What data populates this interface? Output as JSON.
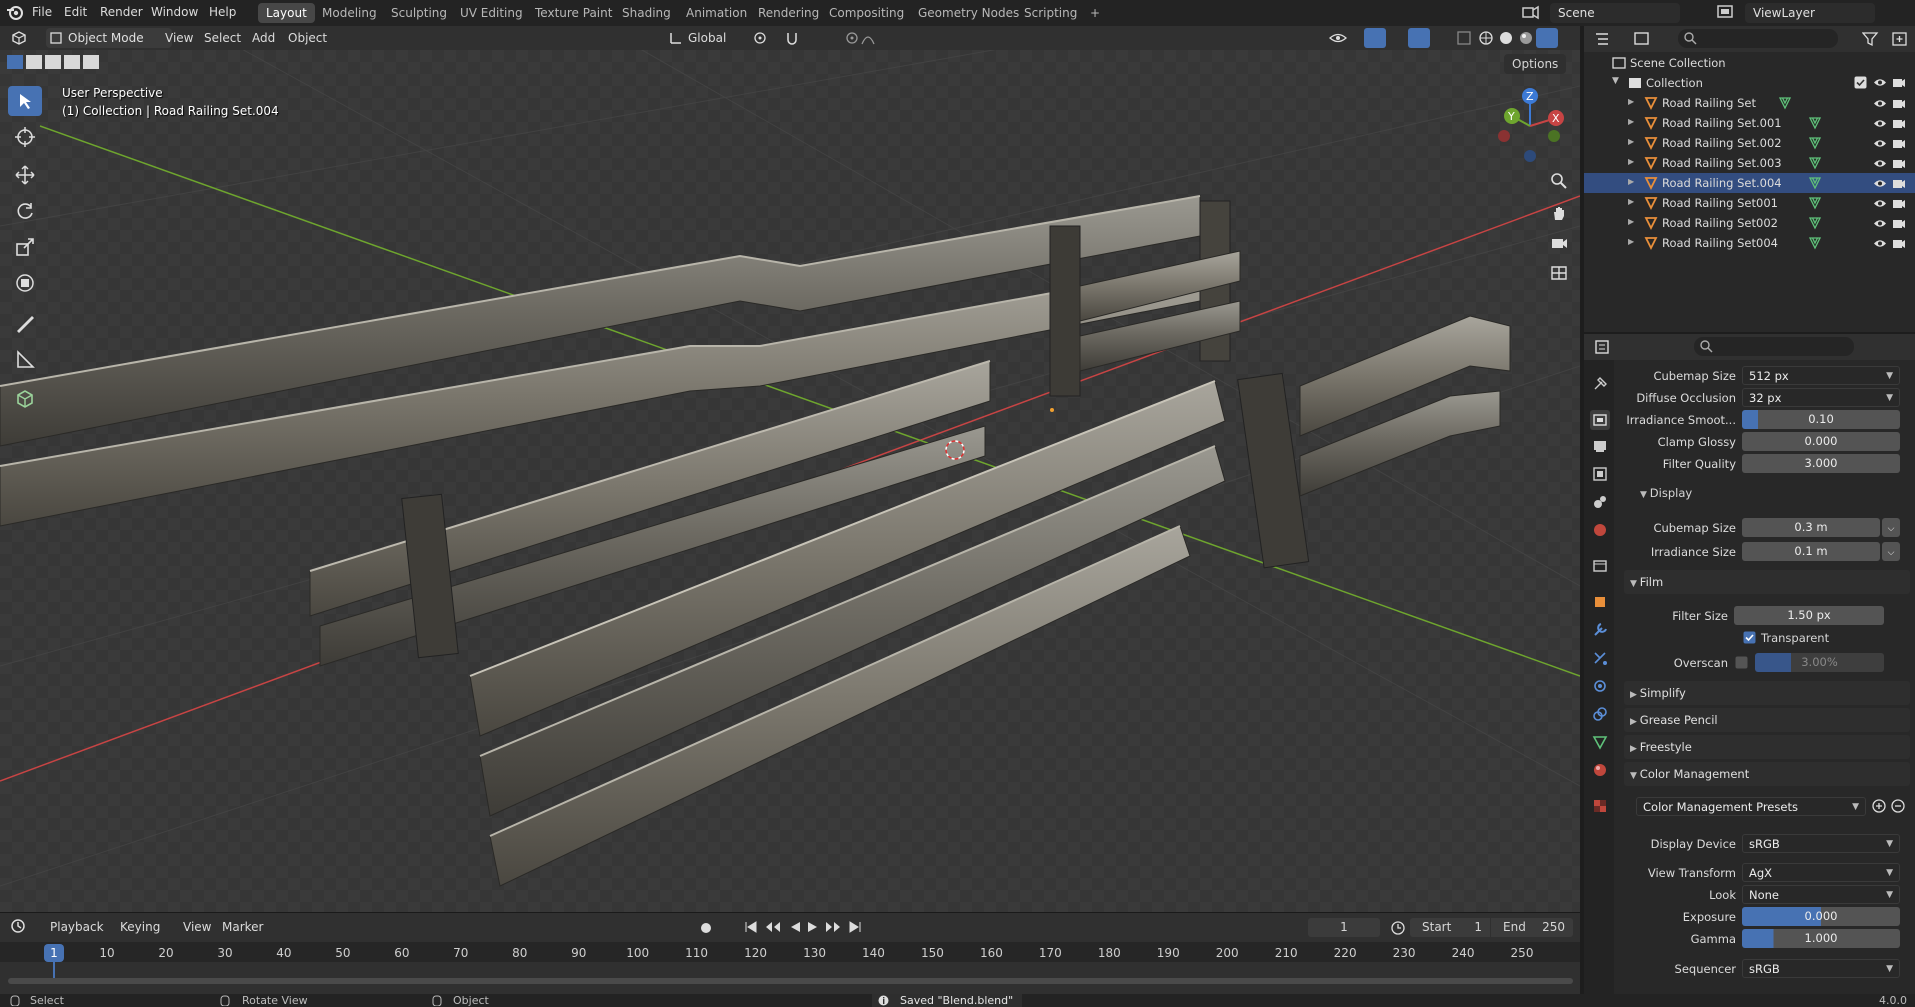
{
  "top_menu": {
    "items": [
      "File",
      "Edit",
      "Render",
      "Window",
      "Help"
    ],
    "workspaces": [
      "Layout",
      "Modeling",
      "Sculpting",
      "UV Editing",
      "Texture Paint",
      "Shading",
      "Animation",
      "Rendering",
      "Compositing",
      "Geometry Nodes",
      "Scripting"
    ],
    "active_workspace": "Layout",
    "add_tab": "+",
    "scene": "Scene",
    "view_layer": "ViewLayer"
  },
  "viewport_header": {
    "mode": "Object Mode",
    "menus": [
      "View",
      "Select",
      "Add",
      "Object"
    ],
    "transform_orientation": "Global",
    "options": "Options"
  },
  "viewport": {
    "perspective": "User Perspective",
    "context": "(1) Collection | Road Railing Set.004",
    "gizmo_axes": [
      "X",
      "Y",
      "Z"
    ]
  },
  "timeline": {
    "menus": [
      "Playback",
      "Keying",
      "View",
      "Marker"
    ],
    "current_frame": "1",
    "start_label": "Start",
    "start": "1",
    "end_label": "End",
    "end": "250",
    "ticks": [
      "1",
      "10",
      "20",
      "30",
      "40",
      "50",
      "60",
      "70",
      "80",
      "90",
      "100",
      "110",
      "120",
      "130",
      "140",
      "150",
      "160",
      "170",
      "180",
      "190",
      "200",
      "210",
      "220",
      "230",
      "240",
      "250"
    ]
  },
  "statusbar": {
    "select": "Select",
    "rotate": "Rotate View",
    "object": "Object",
    "message": "Saved \"Blend.blend\"",
    "version": "4.0.0"
  },
  "outliner": {
    "scene_collection": "Scene Collection",
    "collection": "Collection",
    "objects": [
      "Road Railing Set",
      "Road Railing Set.001",
      "Road Railing Set.002",
      "Road Railing Set.003",
      "Road Railing Set.004",
      "Road Railing Set001",
      "Road Railing Set002",
      "Road Railing Set004"
    ],
    "selected_index": 4
  },
  "properties": {
    "cubemap_size_label": "Cubemap Size",
    "cubemap_size": "512 px",
    "diffuse_occlusion_label": "Diffuse Occlusion",
    "diffuse_occlusion": "32 px",
    "irradiance_smooth_label": "Irradiance Smoot...",
    "irradiance_smooth": "0.10",
    "clamp_glossy_label": "Clamp Glossy",
    "clamp_glossy": "0.000",
    "filter_quality_label": "Filter Quality",
    "filter_quality": "3.000",
    "display_panel": "Display",
    "display_cubemap_label": "Cubemap Size",
    "display_cubemap": "0.3 m",
    "display_irradiance_label": "Irradiance Size",
    "display_irradiance": "0.1 m",
    "film_panel": "Film",
    "filter_size_label": "Filter Size",
    "filter_size": "1.50 px",
    "transparent_label": "Transparent",
    "overscan_label": "Overscan",
    "overscan": "3.00%",
    "simplify_panel": "Simplify",
    "grease_pencil_panel": "Grease Pencil",
    "freestyle_panel": "Freestyle",
    "color_mgmt_panel": "Color Management",
    "color_presets": "Color Management Presets",
    "display_device_label": "Display Device",
    "display_device": "sRGB",
    "view_transform_label": "View Transform",
    "view_transform": "AgX",
    "look_label": "Look",
    "look": "None",
    "exposure_label": "Exposure",
    "exposure": "0.000",
    "gamma_label": "Gamma",
    "gamma": "1.000",
    "sequencer_label": "Sequencer",
    "sequencer": "sRGB"
  },
  "colors": {
    "accent": "#4772b3",
    "x_axis": "#c74444",
    "y_axis": "#6ea52e",
    "z_axis": "#3c7ad6",
    "object_icon": "#e98f3a",
    "mesh_data_icon": "#5fc27a"
  }
}
